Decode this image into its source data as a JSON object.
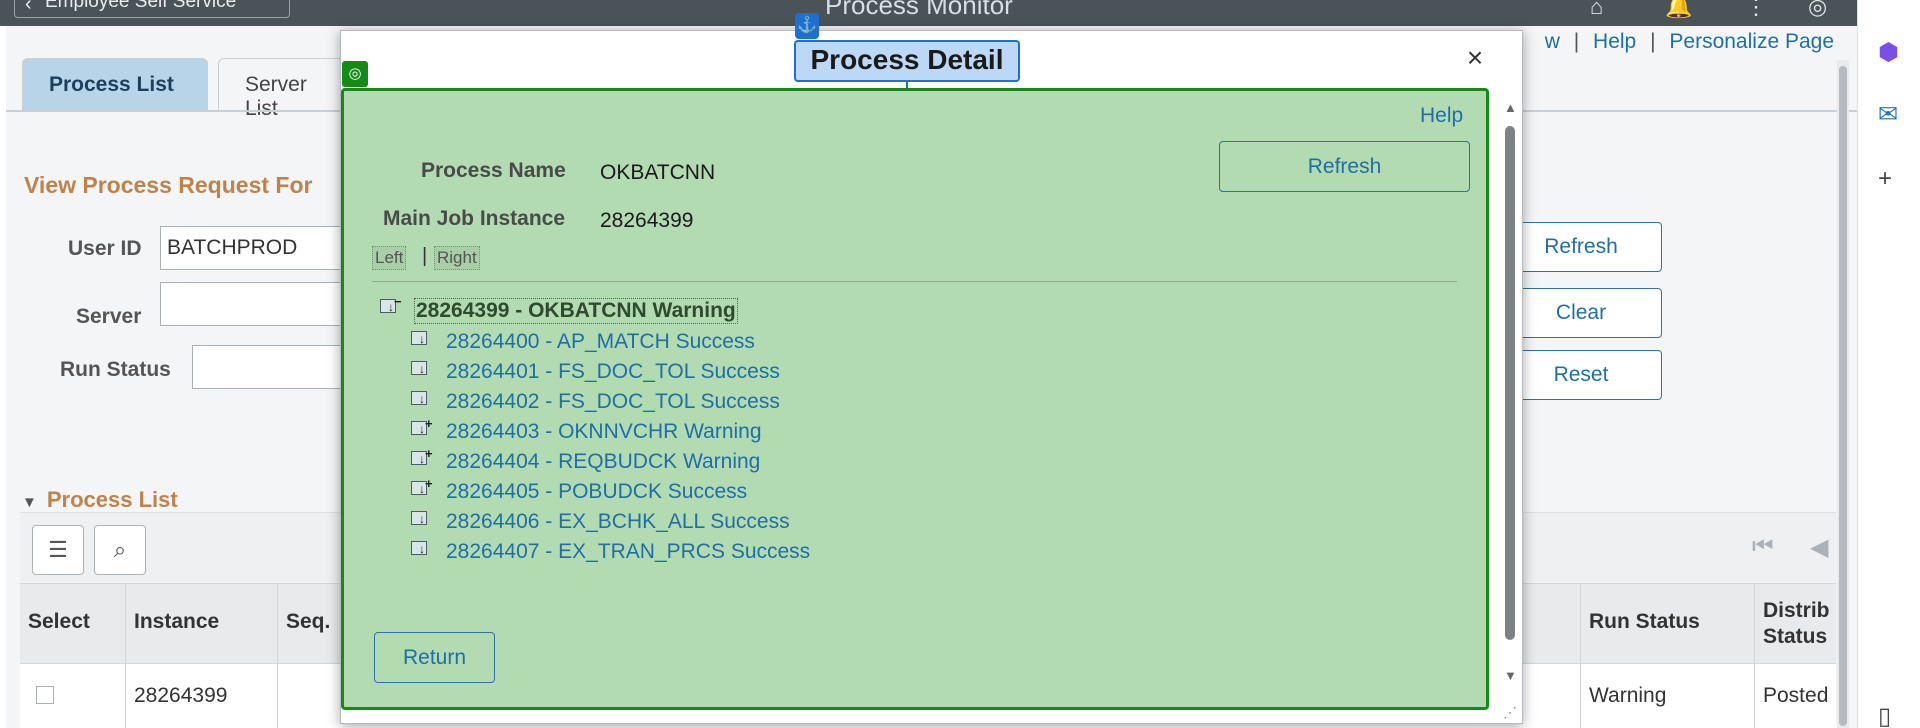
{
  "topbar": {
    "back_label": "Employee Self Service",
    "title": "Process Monitor"
  },
  "tabs": [
    {
      "label": "Process List"
    },
    {
      "label": "Server List"
    }
  ],
  "toplinks": {
    "partial": "w",
    "help": "Help",
    "personalize": "Personalize Page"
  },
  "view_request": {
    "heading": "View Process Request For",
    "user_id_label": "User ID",
    "user_id_value": "BATCHPROD",
    "server_label": "Server",
    "server_value": "",
    "run_status_label": "Run Status",
    "run_status_value": ""
  },
  "bg_buttons": {
    "refresh": "Refresh",
    "clear": "Clear",
    "reset": "Reset"
  },
  "process_list": {
    "section_title": "Process List",
    "columns": [
      "Select",
      "Instance",
      "Seq.",
      "Run Status",
      "Distrib Status"
    ],
    "rows": [
      {
        "instance": "28264399",
        "seq": "",
        "run_status": "Warning",
        "distrib_status": "Posted"
      }
    ]
  },
  "modal": {
    "title": "Process Detail",
    "help": "Help",
    "refresh": "Refresh",
    "process_name_label": "Process Name",
    "process_name_value": "OKBATCNN",
    "main_job_label": "Main Job Instance",
    "main_job_value": "28264399",
    "left_link": "Left",
    "right_link": "Right",
    "lr_separator": "|",
    "tree_root": "28264399 - OKBATCNN Warning",
    "tree_items": [
      {
        "label": "28264400 - AP_MATCH Success",
        "expandable": false
      },
      {
        "label": "28264401 - FS_DOC_TOL Success",
        "expandable": false
      },
      {
        "label": "28264402 - FS_DOC_TOL Success",
        "expandable": false
      },
      {
        "label": "28264403 - OKNNVCHR Warning",
        "expandable": true
      },
      {
        "label": "28264404 - REQBUDCK Warning",
        "expandable": true
      },
      {
        "label": "28264405 - POBUDCK Success",
        "expandable": true
      },
      {
        "label": "28264406 - EX_BCHK_ALL Success",
        "expandable": false
      },
      {
        "label": "28264407 - EX_TRAN_PRCS Success",
        "expandable": false
      }
    ],
    "return": "Return"
  },
  "icons": {
    "close": "close-icon",
    "anchor": "anchor-icon",
    "search": "search-icon",
    "bell": "bell-icon",
    "home": "home-icon"
  },
  "colors": {
    "panel_green": "#b3dbb2",
    "panel_border": "#168a16",
    "link_blue": "#1e6fa6",
    "heading_orange": "#c0824b",
    "topbar": "#4a5358"
  }
}
